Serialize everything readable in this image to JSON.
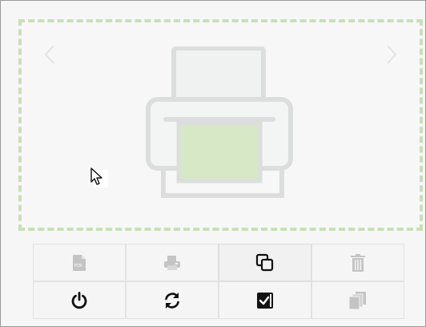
{
  "preview": {
    "prev_icon": "chevron-left-icon",
    "next_icon": "chevron-right-icon",
    "placeholder_icon": "printer-icon",
    "drop_border_color": "#c9dfb8"
  },
  "toolbar": {
    "rows": [
      [
        {
          "icon": "pdf-file-icon",
          "label": "PDF",
          "enabled": false
        },
        {
          "icon": "printer-small-icon",
          "enabled": false
        },
        {
          "icon": "copy-icon",
          "enabled": true
        },
        {
          "icon": "trash-icon",
          "enabled": false
        }
      ],
      [
        {
          "icon": "power-icon",
          "enabled": true
        },
        {
          "icon": "refresh-icon",
          "enabled": true
        },
        {
          "icon": "check-square-icon",
          "enabled": true
        },
        {
          "icon": "copies-stack-icon",
          "enabled": false
        }
      ]
    ]
  },
  "colors": {
    "icon_enabled": "#111111",
    "icon_disabled": "#c4c4c4",
    "printer_body": "#dcdedd",
    "paper_green": "#d6e8c6"
  }
}
